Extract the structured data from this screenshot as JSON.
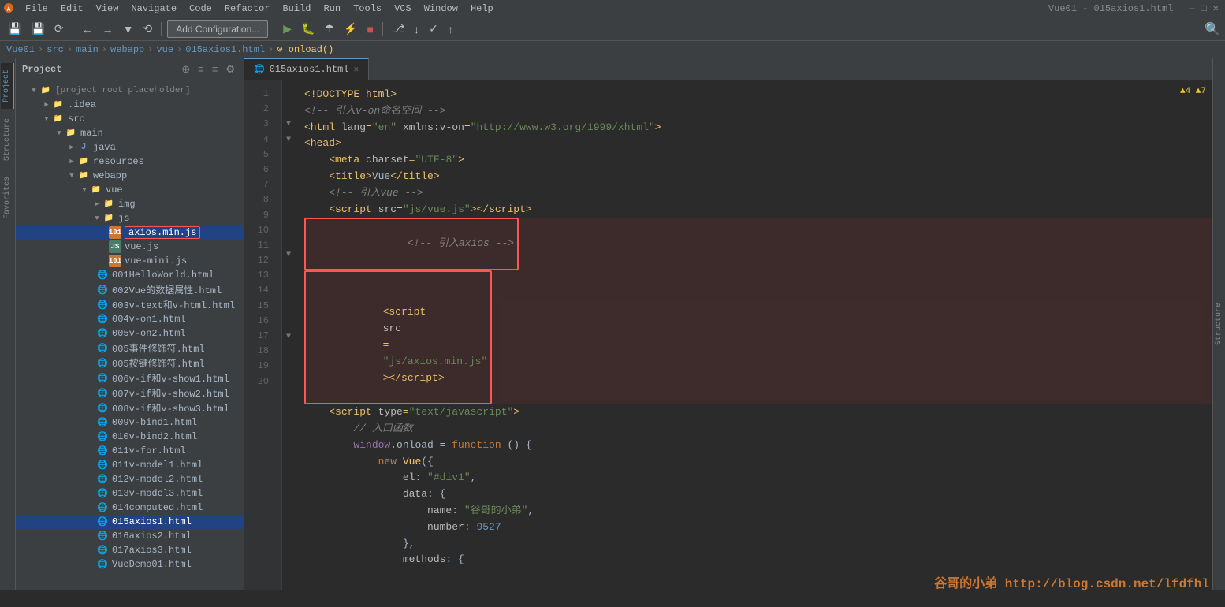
{
  "window": {
    "title": "Vue01 - 015axios1.html"
  },
  "menubar": {
    "items": [
      "File",
      "Edit",
      "View",
      "Navigate",
      "Code",
      "Refactor",
      "Build",
      "Run",
      "Tools",
      "VCS",
      "Window",
      "Help"
    ]
  },
  "toolbar": {
    "add_config_label": "Add Configuration...",
    "run_tip": "Run",
    "debug_tip": "Debug",
    "buttons": [
      "⟲",
      "←",
      "→",
      "▼",
      "⟳"
    ]
  },
  "breadcrumb": {
    "items": [
      "Vue01",
      "src",
      "main",
      "webapp",
      "vue",
      "015axios1.html",
      "onload()"
    ]
  },
  "project_panel": {
    "title": "Project",
    "tree": [
      {
        "level": 0,
        "type": "root",
        "label": "[project root]",
        "expanded": true
      },
      {
        "level": 1,
        "type": "folder",
        "label": ".idea",
        "expanded": false
      },
      {
        "level": 1,
        "type": "folder",
        "label": "src",
        "expanded": true
      },
      {
        "level": 2,
        "type": "folder",
        "label": "main",
        "expanded": true
      },
      {
        "level": 3,
        "type": "folder",
        "label": "java",
        "expanded": false
      },
      {
        "level": 3,
        "type": "folder",
        "label": "resources",
        "expanded": false
      },
      {
        "level": 3,
        "type": "folder",
        "label": "webapp",
        "expanded": true
      },
      {
        "level": 4,
        "type": "folder",
        "label": "vue",
        "expanded": true
      },
      {
        "level": 5,
        "type": "folder",
        "label": "img",
        "expanded": false
      },
      {
        "level": 5,
        "type": "folder",
        "label": "js",
        "expanded": true
      },
      {
        "level": 6,
        "type": "file-js",
        "label": "axios.min.js",
        "selected": true,
        "highlighted": true
      },
      {
        "level": 6,
        "type": "file-js",
        "label": "vue.js"
      },
      {
        "level": 6,
        "type": "file-js",
        "label": "vue-mini.js"
      },
      {
        "level": 5,
        "type": "file-html",
        "label": "001HelloWorld.html"
      },
      {
        "level": 5,
        "type": "file-html",
        "label": "002Vue的数据属性.html"
      },
      {
        "level": 5,
        "type": "file-html",
        "label": "003v-text和v-html.html"
      },
      {
        "level": 5,
        "type": "file-html",
        "label": "004v-on1.html"
      },
      {
        "level": 5,
        "type": "file-html",
        "label": "005v-on2.html"
      },
      {
        "level": 5,
        "type": "file-html",
        "label": "005事件修饰符.html"
      },
      {
        "level": 5,
        "type": "file-html",
        "label": "005按键修饰符.html"
      },
      {
        "level": 5,
        "type": "file-html",
        "label": "006v-if和v-show1.html"
      },
      {
        "level": 5,
        "type": "file-html",
        "label": "007v-if和v-show2.html"
      },
      {
        "level": 5,
        "type": "file-html",
        "label": "008v-if和v-show3.html"
      },
      {
        "level": 5,
        "type": "file-html",
        "label": "009v-bind1.html"
      },
      {
        "level": 5,
        "type": "file-html",
        "label": "010v-bind2.html"
      },
      {
        "level": 5,
        "type": "file-html",
        "label": "011v-for.html"
      },
      {
        "level": 5,
        "type": "file-html",
        "label": "011v-model1.html"
      },
      {
        "level": 5,
        "type": "file-html",
        "label": "012v-model2.html"
      },
      {
        "level": 5,
        "type": "file-html",
        "label": "013v-model3.html"
      },
      {
        "level": 5,
        "type": "file-html",
        "label": "014computed.html"
      },
      {
        "level": 5,
        "type": "file-html",
        "label": "015axios1.html",
        "selected": true
      },
      {
        "level": 5,
        "type": "file-html",
        "label": "016axios2.html"
      },
      {
        "level": 5,
        "type": "file-html",
        "label": "017axios3.html"
      },
      {
        "level": 5,
        "type": "file-html",
        "label": "VueDemo01.html"
      }
    ]
  },
  "editor": {
    "tab_label": "015axios1.html",
    "warnings": "▲4 ▲7",
    "lines": [
      {
        "num": 1,
        "tokens": [
          {
            "t": "<!DOCTYPE html>",
            "c": "kw-tag"
          }
        ]
      },
      {
        "num": 2,
        "tokens": [
          {
            "t": "<!-- ",
            "c": "kw-comment"
          },
          {
            "t": "引入v-on命名空间",
            "c": "kw-comment"
          },
          {
            "t": " -->",
            "c": "kw-comment"
          }
        ]
      },
      {
        "num": 3,
        "fold": true,
        "tokens": [
          {
            "t": "<html ",
            "c": "kw-tag"
          },
          {
            "t": "lang",
            "c": "kw-attr"
          },
          {
            "t": "=\"en\" ",
            "c": "kw-val"
          },
          {
            "t": "xmlns:v-on",
            "c": "kw-attr"
          },
          {
            "t": "=",
            "c": "kw-tag"
          },
          {
            "t": "\"http://www.w3.org/1999/xhtml\"",
            "c": "kw-val"
          },
          {
            "t": ">",
            "c": "kw-tag"
          }
        ]
      },
      {
        "num": 4,
        "fold": true,
        "tokens": [
          {
            "t": "<head>",
            "c": "kw-tag"
          }
        ]
      },
      {
        "num": 5,
        "tokens": [
          {
            "t": "    <meta ",
            "c": "kw-tag"
          },
          {
            "t": "charset",
            "c": "kw-attr"
          },
          {
            "t": "=",
            "c": "kw-tag"
          },
          {
            "t": "\"UTF-8\"",
            "c": "kw-val"
          },
          {
            "t": ">",
            "c": "kw-tag"
          }
        ]
      },
      {
        "num": 6,
        "tokens": [
          {
            "t": "    <title>",
            "c": "kw-tag"
          },
          {
            "t": "Vue",
            "c": "kw-plain"
          },
          {
            "t": "</title>",
            "c": "kw-tag"
          }
        ]
      },
      {
        "num": 7,
        "tokens": [
          {
            "t": "    <!-- ",
            "c": "kw-comment"
          },
          {
            "t": "引入vue",
            "c": "kw-comment"
          },
          {
            "t": " -->",
            "c": "kw-comment"
          }
        ]
      },
      {
        "num": 8,
        "tokens": [
          {
            "t": "    <script ",
            "c": "kw-tag"
          },
          {
            "t": "src",
            "c": "kw-attr"
          },
          {
            "t": "=",
            "c": "kw-tag"
          },
          {
            "t": "\"js/vue.js\"",
            "c": "kw-val"
          },
          {
            "t": "></",
            "c": "kw-tag"
          },
          {
            "t": "script",
            "c": "kw-tag"
          },
          {
            "t": ">",
            "c": "kw-tag"
          }
        ]
      },
      {
        "num": 9,
        "highlight": true,
        "tokens": [
          {
            "t": "    <!-- ",
            "c": "kw-comment"
          },
          {
            "t": "引入axios",
            "c": "kw-comment"
          },
          {
            "t": " -->",
            "c": "kw-comment"
          }
        ]
      },
      {
        "num": 10,
        "highlight": true,
        "tokens": [
          {
            "t": "    <script ",
            "c": "kw-tag"
          },
          {
            "t": "src",
            "c": "kw-attr"
          },
          {
            "t": "=",
            "c": "kw-tag"
          },
          {
            "t": "\"js/axios.min.js\"",
            "c": "kw-val"
          },
          {
            "t": "></",
            "c": "kw-tag"
          },
          {
            "t": "script",
            "c": "kw-tag"
          },
          {
            "t": ">",
            "c": "kw-tag"
          }
        ]
      },
      {
        "num": 11,
        "fold": true,
        "tokens": [
          {
            "t": "    <script ",
            "c": "kw-tag"
          },
          {
            "t": "type",
            "c": "kw-attr"
          },
          {
            "t": "=",
            "c": "kw-tag"
          },
          {
            "t": "\"text/javascript\"",
            "c": "kw-val"
          },
          {
            "t": ">",
            "c": "kw-tag"
          }
        ]
      },
      {
        "num": 12,
        "tokens": [
          {
            "t": "        // ",
            "c": "kw-comment"
          },
          {
            "t": "入口函数",
            "c": "kw-comment"
          }
        ]
      },
      {
        "num": 13,
        "tokens": [
          {
            "t": "        ",
            "c": "kw-plain"
          },
          {
            "t": "window",
            "c": "kw-var"
          },
          {
            "t": ".onload = ",
            "c": "kw-plain"
          },
          {
            "t": "function",
            "c": "kw-keyword"
          },
          {
            "t": " () {",
            "c": "kw-plain"
          }
        ]
      },
      {
        "num": 14,
        "tokens": [
          {
            "t": "            ",
            "c": "kw-plain"
          },
          {
            "t": "new ",
            "c": "kw-keyword"
          },
          {
            "t": "Vue",
            "c": "kw-func"
          },
          {
            "t": "({",
            "c": "kw-plain"
          }
        ]
      },
      {
        "num": 15,
        "tokens": [
          {
            "t": "                ",
            "c": "kw-plain"
          },
          {
            "t": "el",
            "c": "kw-attr"
          },
          {
            "t": ": ",
            "c": "kw-plain"
          },
          {
            "t": "\"#div1\"",
            "c": "kw-string"
          },
          {
            "t": ",",
            "c": "kw-plain"
          }
        ]
      },
      {
        "num": 16,
        "fold": true,
        "tokens": [
          {
            "t": "                ",
            "c": "kw-plain"
          },
          {
            "t": "data",
            "c": "kw-attr"
          },
          {
            "t": ": {",
            "c": "kw-plain"
          }
        ]
      },
      {
        "num": 17,
        "tokens": [
          {
            "t": "                    ",
            "c": "kw-plain"
          },
          {
            "t": "name",
            "c": "kw-attr"
          },
          {
            "t": ": ",
            "c": "kw-plain"
          },
          {
            "t": "\"谷哥的小弟\"",
            "c": "kw-string"
          },
          {
            "t": ",",
            "c": "kw-plain"
          }
        ]
      },
      {
        "num": 18,
        "tokens": [
          {
            "t": "                    ",
            "c": "kw-plain"
          },
          {
            "t": "number",
            "c": "kw-attr"
          },
          {
            "t": ": ",
            "c": "kw-plain"
          },
          {
            "t": "9527",
            "c": "kw-number"
          }
        ]
      },
      {
        "num": 19,
        "tokens": [
          {
            "t": "                },",
            "c": "kw-plain"
          }
        ]
      },
      {
        "num": 20,
        "tokens": [
          {
            "t": "                ",
            "c": "kw-plain"
          },
          {
            "t": "methods",
            "c": "kw-attr"
          },
          {
            "t": ": {",
            "c": "kw-plain"
          }
        ]
      }
    ]
  },
  "watermark": {
    "text": "谷哥的小弟 http://blog.csdn.net/lfdfhl"
  },
  "side_labels": {
    "project": "Project",
    "structure": "Structure",
    "favorites": "Favorites"
  }
}
